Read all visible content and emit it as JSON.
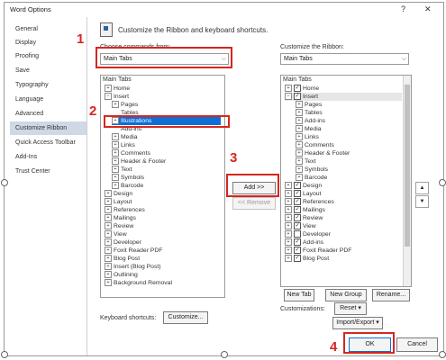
{
  "window": {
    "title": "Word Options",
    "help": "?",
    "close": "✕"
  },
  "sidebar": {
    "items": [
      {
        "label": "General"
      },
      {
        "label": "Display"
      },
      {
        "label": "Proofing"
      },
      {
        "label": "Save"
      },
      {
        "label": "Typography"
      },
      {
        "label": "Language"
      },
      {
        "label": "Advanced"
      },
      {
        "label": "Customize Ribbon"
      },
      {
        "label": "Quick Access Toolbar"
      },
      {
        "label": "Add-Ins"
      },
      {
        "label": "Trust Center"
      }
    ],
    "selected": "Customize Ribbon"
  },
  "header": {
    "text": "Customize the Ribbon and keyboard shortcuts."
  },
  "left": {
    "choose_label": "Choose commands from:",
    "choose_value": "Main Tabs",
    "list_header": "Main Tabs",
    "items": [
      {
        "toggle": "+",
        "label": "Home"
      },
      {
        "toggle": "−",
        "label": "Insert"
      },
      {
        "toggle": "+",
        "label": "Pages"
      },
      {
        "toggle": "",
        "label": "Tables"
      },
      {
        "toggle": "+",
        "label": "Illustrations"
      },
      {
        "toggle": "",
        "label": "Add-ins"
      },
      {
        "toggle": "+",
        "label": "Media"
      },
      {
        "toggle": "+",
        "label": "Links"
      },
      {
        "toggle": "+",
        "label": "Comments"
      },
      {
        "toggle": "+",
        "label": "Header & Footer"
      },
      {
        "toggle": "+",
        "label": "Text"
      },
      {
        "toggle": "+",
        "label": "Symbols"
      },
      {
        "toggle": "+",
        "label": "Barcode"
      },
      {
        "toggle": "+",
        "label": "Design"
      },
      {
        "toggle": "+",
        "label": "Layout"
      },
      {
        "toggle": "+",
        "label": "References"
      },
      {
        "toggle": "+",
        "label": "Mailings"
      },
      {
        "toggle": "+",
        "label": "Review"
      },
      {
        "toggle": "+",
        "label": "View"
      },
      {
        "toggle": "+",
        "label": "Developer"
      },
      {
        "toggle": "+",
        "label": "Foxit Reader PDF"
      },
      {
        "toggle": "+",
        "label": "Blog Post"
      },
      {
        "toggle": "+",
        "label": "Insert (Blog Post)"
      },
      {
        "toggle": "+",
        "label": "Outlining"
      },
      {
        "toggle": "+",
        "label": "Background Removal"
      }
    ],
    "selected_item": "Illustrations",
    "keyboard_label": "Keyboard shortcuts:",
    "customize_button": "Customize..."
  },
  "middle": {
    "add_button": "Add >>",
    "remove_button": "<< Remove"
  },
  "right": {
    "customize_label": "Customize the Ribbon:",
    "customize_value": "Main Tabs",
    "list_header": "Main Tabs",
    "items": [
      {
        "toggle": "+",
        "check": "✓",
        "label": "Home"
      },
      {
        "toggle": "−",
        "check": "✓",
        "label": "Insert"
      },
      {
        "toggle": "+",
        "check": "",
        "label": "Pages"
      },
      {
        "toggle": "+",
        "check": "",
        "label": "Tables"
      },
      {
        "toggle": "+",
        "check": "",
        "label": "Add-ins"
      },
      {
        "toggle": "+",
        "check": "",
        "label": "Media"
      },
      {
        "toggle": "+",
        "check": "",
        "label": "Links"
      },
      {
        "toggle": "+",
        "check": "",
        "label": "Comments"
      },
      {
        "toggle": "+",
        "check": "",
        "label": "Header & Footer"
      },
      {
        "toggle": "+",
        "check": "",
        "label": "Text"
      },
      {
        "toggle": "+",
        "check": "",
        "label": "Symbols"
      },
      {
        "toggle": "+",
        "check": "",
        "label": "Barcode"
      },
      {
        "toggle": "+",
        "check": "✓",
        "label": "Design"
      },
      {
        "toggle": "+",
        "check": "✓",
        "label": "Layout"
      },
      {
        "toggle": "+",
        "check": "✓",
        "label": "References"
      },
      {
        "toggle": "+",
        "check": "✓",
        "label": "Mailings"
      },
      {
        "toggle": "+",
        "check": "✓",
        "label": "Review"
      },
      {
        "toggle": "+",
        "check": "✓",
        "label": "View"
      },
      {
        "toggle": "+",
        "check": "",
        "label": "Developer"
      },
      {
        "toggle": "+",
        "check": "✓",
        "label": "Add-ins"
      },
      {
        "toggle": "+",
        "check": "✓",
        "label": "Foxit Reader PDF"
      },
      {
        "toggle": "+",
        "check": "✓",
        "label": "Blog Post"
      }
    ],
    "new_tab": "New Tab",
    "new_group": "New Group",
    "rename": "Rename...",
    "customizations_label": "Customizations:",
    "reset": "Reset ▾",
    "import_export": "Import/Export ▾",
    "up": "▲",
    "down": "▼"
  },
  "footer": {
    "ok": "OK",
    "cancel": "Cancel"
  },
  "annotations": {
    "one": "1",
    "two": "2",
    "three": "3",
    "four": "4"
  },
  "colors": {
    "highlight": "#d7261e",
    "selection": "#0b6fd6",
    "sidebar_selected": "#cfd8e7"
  }
}
